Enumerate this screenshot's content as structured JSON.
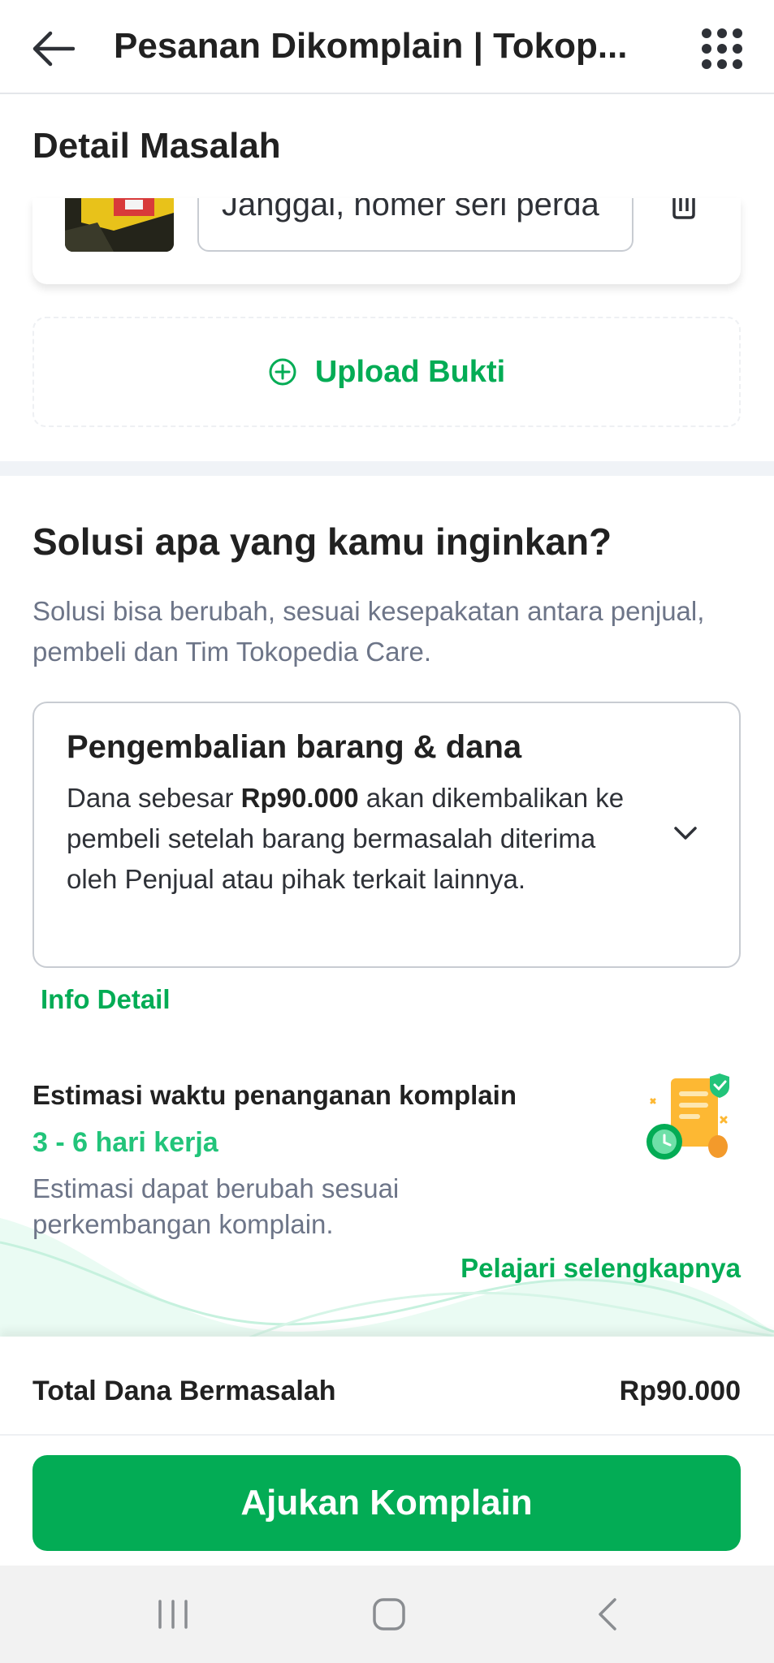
{
  "header": {
    "title": "Pesanan Dikomplain | Tokop...",
    "back_icon": "arrow-left-icon",
    "menu_icon": "grid-menu-icon"
  },
  "detail": {
    "title": "Detail Masalah",
    "evidence_text": "Janggal, nomer seri perda",
    "delete_icon": "trash-icon",
    "upload_label": "Upload Bukti",
    "upload_icon": "plus-circle-icon"
  },
  "solution": {
    "title": "Solusi apa yang kamu inginkan?",
    "subtitle": "Solusi bisa berubah, sesuai kesepakatan antara penjual, pembeli dan Tim Tokopedia Care.",
    "selected": {
      "name": "Pengembalian barang & dana",
      "desc_prefix": "Dana sebesar ",
      "amount": "Rp90.000",
      "desc_suffix": " akan dikembalikan ke pembeli setelah barang bermasalah diterima oleh Penjual atau pihak terkait lainnya."
    },
    "info_detail": "Info Detail"
  },
  "estimate": {
    "title": "Estimasi waktu penanganan komplain",
    "days": "3 - 6 hari kerja",
    "note": "Estimasi dapat berubah sesuai perkembangan komplain.",
    "learn_more": "Pelajari selengkapnya"
  },
  "footer": {
    "total_label": "Total Dana Bermasalah",
    "total_value": "Rp90.000",
    "submit_label": "Ajukan Komplain"
  },
  "colors": {
    "accent": "#03ac55",
    "text": "#212121",
    "muted": "#6d7588"
  }
}
